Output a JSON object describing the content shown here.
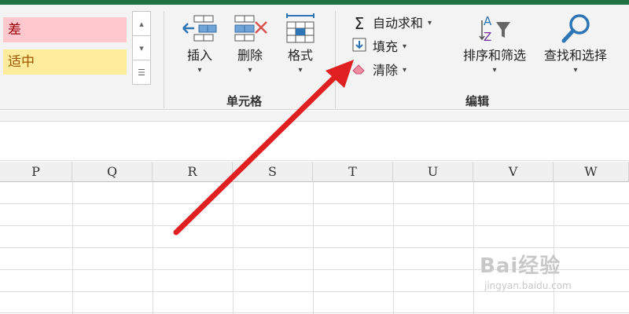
{
  "ribbon": {
    "styles": {
      "bad_label": "差",
      "neutral_label": "适中",
      "bad_bg": "#ffc7ce",
      "bad_fg": "#9c0006",
      "neutral_bg": "#ffeb9c",
      "neutral_fg": "#9c5700"
    },
    "cells_group": {
      "label": "单元格",
      "insert": "插入",
      "delete": "删除",
      "format": "格式"
    },
    "editing_group": {
      "label": "编辑",
      "autosum": "自动求和",
      "fill": "填充",
      "clear": "清除",
      "sort_filter": "排序和筛选",
      "find_select": "查找和选择"
    }
  },
  "sheet": {
    "columns": [
      "P",
      "Q",
      "R",
      "S",
      "T",
      "U",
      "V",
      "W"
    ]
  },
  "annotation": {
    "arrow_color": "#e02020"
  },
  "watermark": {
    "main": "Bai经验",
    "sub": "jingyan.baidu.com"
  }
}
